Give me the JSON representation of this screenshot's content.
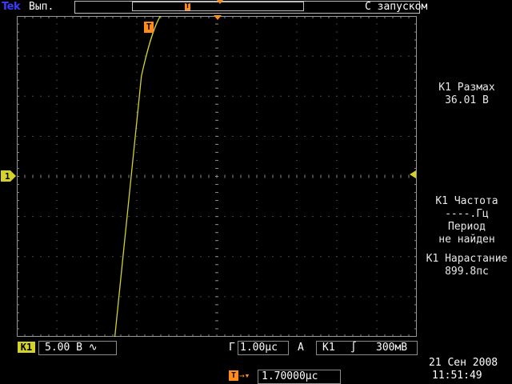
{
  "header": {
    "brand": "Tek",
    "run_status": "Вып.",
    "trigger_status": "С запуском"
  },
  "measurements": [
    {
      "label": "К1 Размах",
      "value": "36.01 В"
    },
    {
      "label": "К1 Частота",
      "value": "----.Гц"
    },
    {
      "label": "Период",
      "value": "не найден"
    },
    {
      "label": "К1 Нарастание",
      "value": "899.8пс"
    }
  ],
  "channel": {
    "badge": "К1",
    "scale": "5.00 В",
    "coupling_symbol": "∿",
    "marker": "1",
    "color": "#d4d22a"
  },
  "timebase": {
    "label": "Г",
    "value": "1.00µс"
  },
  "trigger": {
    "mode": "А",
    "source": "К1",
    "slope_symbol": "∫",
    "level": "300мВ",
    "marker": "T",
    "color": "#ff8c1a"
  },
  "horizontal_position": {
    "icon": "T",
    "arrow": "→▾",
    "value": "1.70000µс"
  },
  "datetime": {
    "date": "21 Сен  2008",
    "time": "11:51:49"
  },
  "waveform": {
    "low_level_div": -4.5,
    "high_level_div": 4.4,
    "rise_start_div": -2.6,
    "rise_end_div": -1.3,
    "settle_div": 0.6
  }
}
